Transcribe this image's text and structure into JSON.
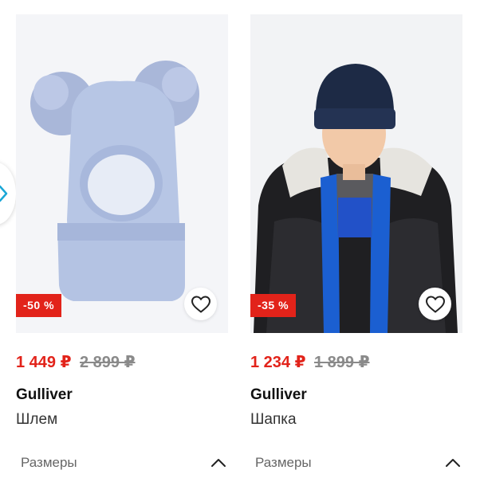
{
  "products": [
    {
      "discount": "-50 %",
      "price": "1 449 ₽",
      "old_price": "2 899 ₽",
      "brand": "Gulliver",
      "name": "Шлем",
      "sizes_label": "Размеры"
    },
    {
      "discount": "-35 %",
      "price": "1 234 ₽",
      "old_price": "1 899 ₽",
      "brand": "Gulliver",
      "name": "Шапка",
      "sizes_label": "Размеры"
    }
  ],
  "colors": {
    "accent": "#e2231a",
    "badge": "#e2231a",
    "old_price": "#8a8a8a",
    "nav_arrow": "#1aa7d6"
  },
  "icons": {
    "favorite": "heart-icon",
    "expand": "chevron-up-icon",
    "carousel_prev": "chevron-right-icon"
  }
}
